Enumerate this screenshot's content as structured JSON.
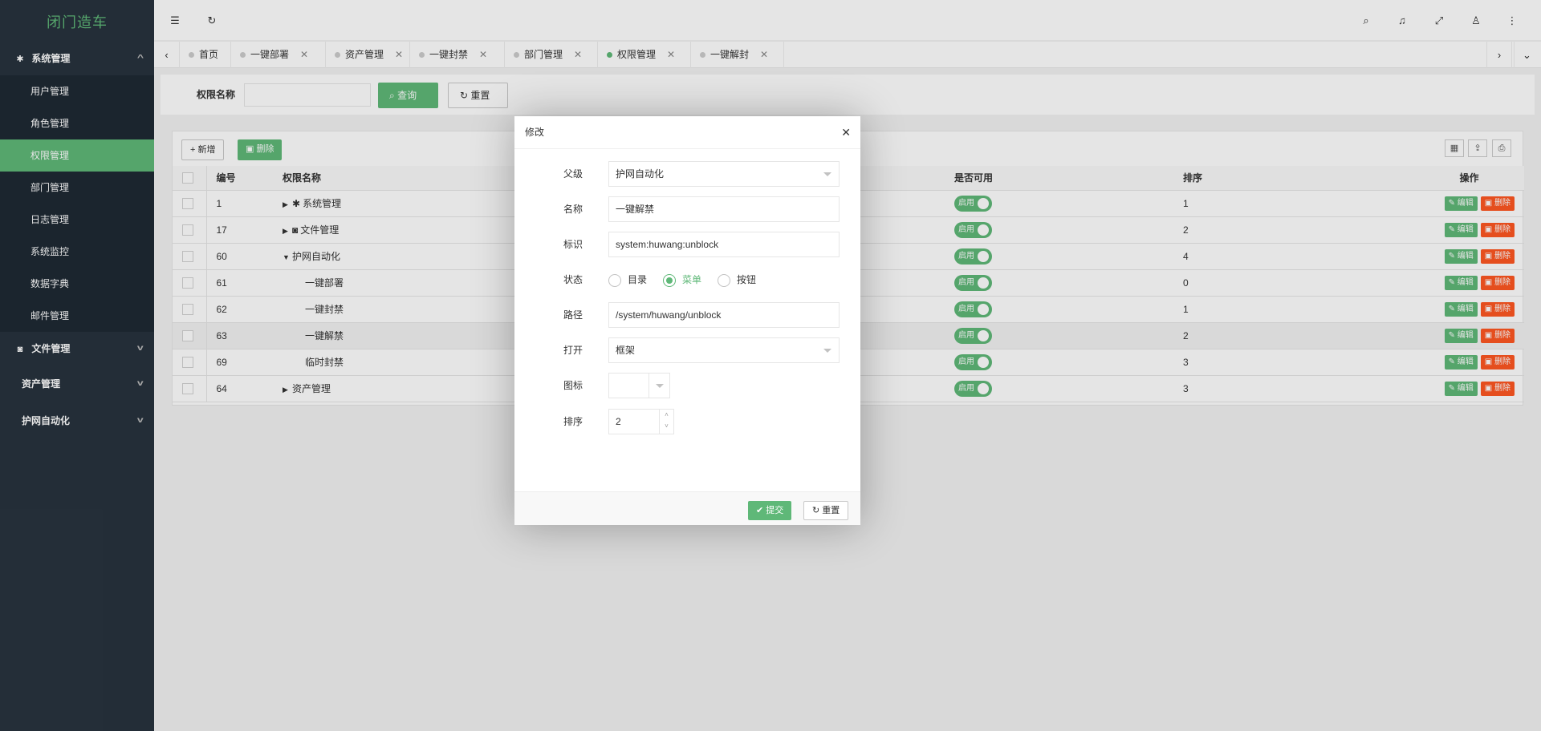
{
  "brand": "闭门造车",
  "sidebar": {
    "system_group": "系统管理",
    "items": [
      "用户管理",
      "角色管理",
      "权限管理",
      "部门管理",
      "日志管理",
      "系统监控",
      "数据字典",
      "邮件管理"
    ],
    "file_group": "文件管理",
    "asset_group": "资产管理",
    "auto_group": "护网自动化"
  },
  "tabs": [
    "首页",
    "一键部署",
    "资产管理",
    "一键封禁",
    "部门管理",
    "权限管理",
    "一键解封"
  ],
  "search": {
    "label": "权限名称",
    "query_btn": "查询",
    "reset_btn": "重置"
  },
  "toolbar": {
    "add_btn": "新增",
    "delete_btn": "删除"
  },
  "table": {
    "headers": {
      "id": "编号",
      "name": "权限名称",
      "enabled": "是否可用",
      "sort": "排序",
      "ops": "操作"
    },
    "rows": [
      {
        "id": "1",
        "name": "系统管理",
        "sort": "1"
      },
      {
        "id": "17",
        "name": "文件管理",
        "sort": "2"
      },
      {
        "id": "60",
        "name": "护网自动化",
        "sort": "4"
      },
      {
        "id": "61",
        "name": "一键部署",
        "sort": "0"
      },
      {
        "id": "62",
        "name": "一键封禁",
        "sort": "1"
      },
      {
        "id": "63",
        "name": "一键解禁",
        "sort": "2"
      },
      {
        "id": "69",
        "name": "临时封禁",
        "sort": "3"
      },
      {
        "id": "64",
        "name": "资产管理",
        "sort": "3"
      }
    ],
    "enabled_label": "启用",
    "edit_label": "编辑",
    "delete_label": "删除"
  },
  "modal": {
    "title": "修改",
    "parent_label": "父级",
    "parent_value": "护网自动化",
    "name_label": "名称",
    "name_value": "一键解禁",
    "ident_label": "标识",
    "ident_value": "system:huwang:unblock",
    "status_label": "状态",
    "status_options": [
      "目录",
      "菜单",
      "按钮"
    ],
    "status_selected": "菜单",
    "path_label": "路径",
    "path_value": "/system/huwang/unblock",
    "open_label": "打开",
    "open_value": "框架",
    "icon_label": "图标",
    "sort_label": "排序",
    "sort_value": "2",
    "submit_btn": "提交",
    "reset_btn": "重置"
  },
  "colors": {
    "accent": "#5fb878",
    "danger": "#ff5722",
    "sidebar": "#28333e"
  }
}
